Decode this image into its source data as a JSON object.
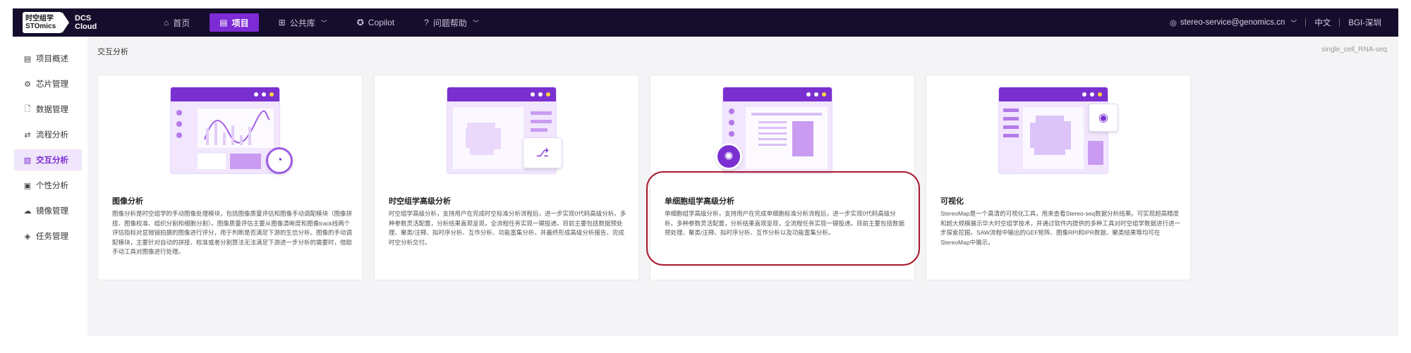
{
  "logo": {
    "line1": "时空组学",
    "line2": "STOmics",
    "product_line1": "DCS",
    "product_line2": "Cloud"
  },
  "nav": {
    "items": [
      {
        "label": "首页",
        "icon": "home-icon",
        "glyph": "⌂"
      },
      {
        "label": "项目",
        "icon": "document-icon",
        "glyph": "▤"
      },
      {
        "label": "公共库",
        "icon": "grid-icon",
        "glyph": "⊞"
      },
      {
        "label": "Copilot",
        "icon": "copilot-icon",
        "glyph": "✪"
      },
      {
        "label": "问题帮助",
        "icon": "help-icon",
        "glyph": "?"
      }
    ],
    "active": "项目",
    "user_email": "stereo-service@genomics.cn",
    "language": "中文",
    "region": "BGI-深圳"
  },
  "sidebar": {
    "items": [
      {
        "label": "项目概述",
        "icon": "overview-icon",
        "glyph": "▤"
      },
      {
        "label": "芯片管理",
        "icon": "chip-icon",
        "glyph": "⚙"
      },
      {
        "label": "数据管理",
        "icon": "data-icon",
        "glyph": "🗋"
      },
      {
        "label": "流程分析",
        "icon": "workflow-icon",
        "glyph": "⇄"
      },
      {
        "label": "交互分析",
        "icon": "interactive-icon",
        "glyph": "▧"
      },
      {
        "label": "个性分析",
        "icon": "personal-icon",
        "glyph": "▣"
      },
      {
        "label": "镜像管理",
        "icon": "image-icon",
        "glyph": "☁"
      },
      {
        "label": "任务管理",
        "icon": "task-icon",
        "glyph": "◈"
      }
    ],
    "active": "交互分析"
  },
  "main": {
    "title": "交互分析",
    "tag": "single_cell_RNA-seq",
    "cards": [
      {
        "title": "图像分析",
        "desc": "图像分析是时空组学的手动图像处理模块，包括图像质量评估和图像手动调配模块（图像拼接、图像校准、组织分割和细胞分割）。图像质量评估主要从图像清晰度和图像track线两个评估指标对显微镜拍摄的图像进行评分，用于判断是否满足下游的生信分析。图像的手动调配模块，主要针对自动的拼接、校准或者分割算法无法满足下游进一步分析的需要时，借助手动工具对图像进行处理。"
      },
      {
        "title": "时空组学高级分析",
        "desc": "时空组学高级分析，支持用户在完成时空标准分析流程后，进一步实现0代码高级分析。多种参数灵活配置，分析结果直观呈现，全流程任务实现一键投递。目前主要包括数据预处理、聚类/注释、拟时序分析、互作分析、功能富集分析，并最终形成高级分析报告，完成时空分析交付。"
      },
      {
        "title": "单细胞组学高级分析",
        "desc": "单细胞组学高级分析，支持用户在完成单细胞标准分析流程后，进一步实现0代码高级分析。多种参数灵活配置，分析结果直观呈现，全流程任务实现一键投递。目前主要包括数据预处理、聚类/注释、拟时序分析、互作分析以及功能富集分析。"
      },
      {
        "title": "可视化",
        "desc": "StereoMap是一个高清的可视化工具，用来查看Stereo-seq数据分析结果。可实现超高精度和超大规模展示华大时空组学技术，并通过软件内提供的多种工具对时空组学数据进行进一步探索挖掘。SAW流程中输出的GEF矩阵、图像RPI和IPR数据、聚类结果等均可在StereoMap中展示。"
      }
    ]
  },
  "colors": {
    "topbar": "#150d2b",
    "accent": "#7d2bd4",
    "highlight": "#a8192e"
  }
}
